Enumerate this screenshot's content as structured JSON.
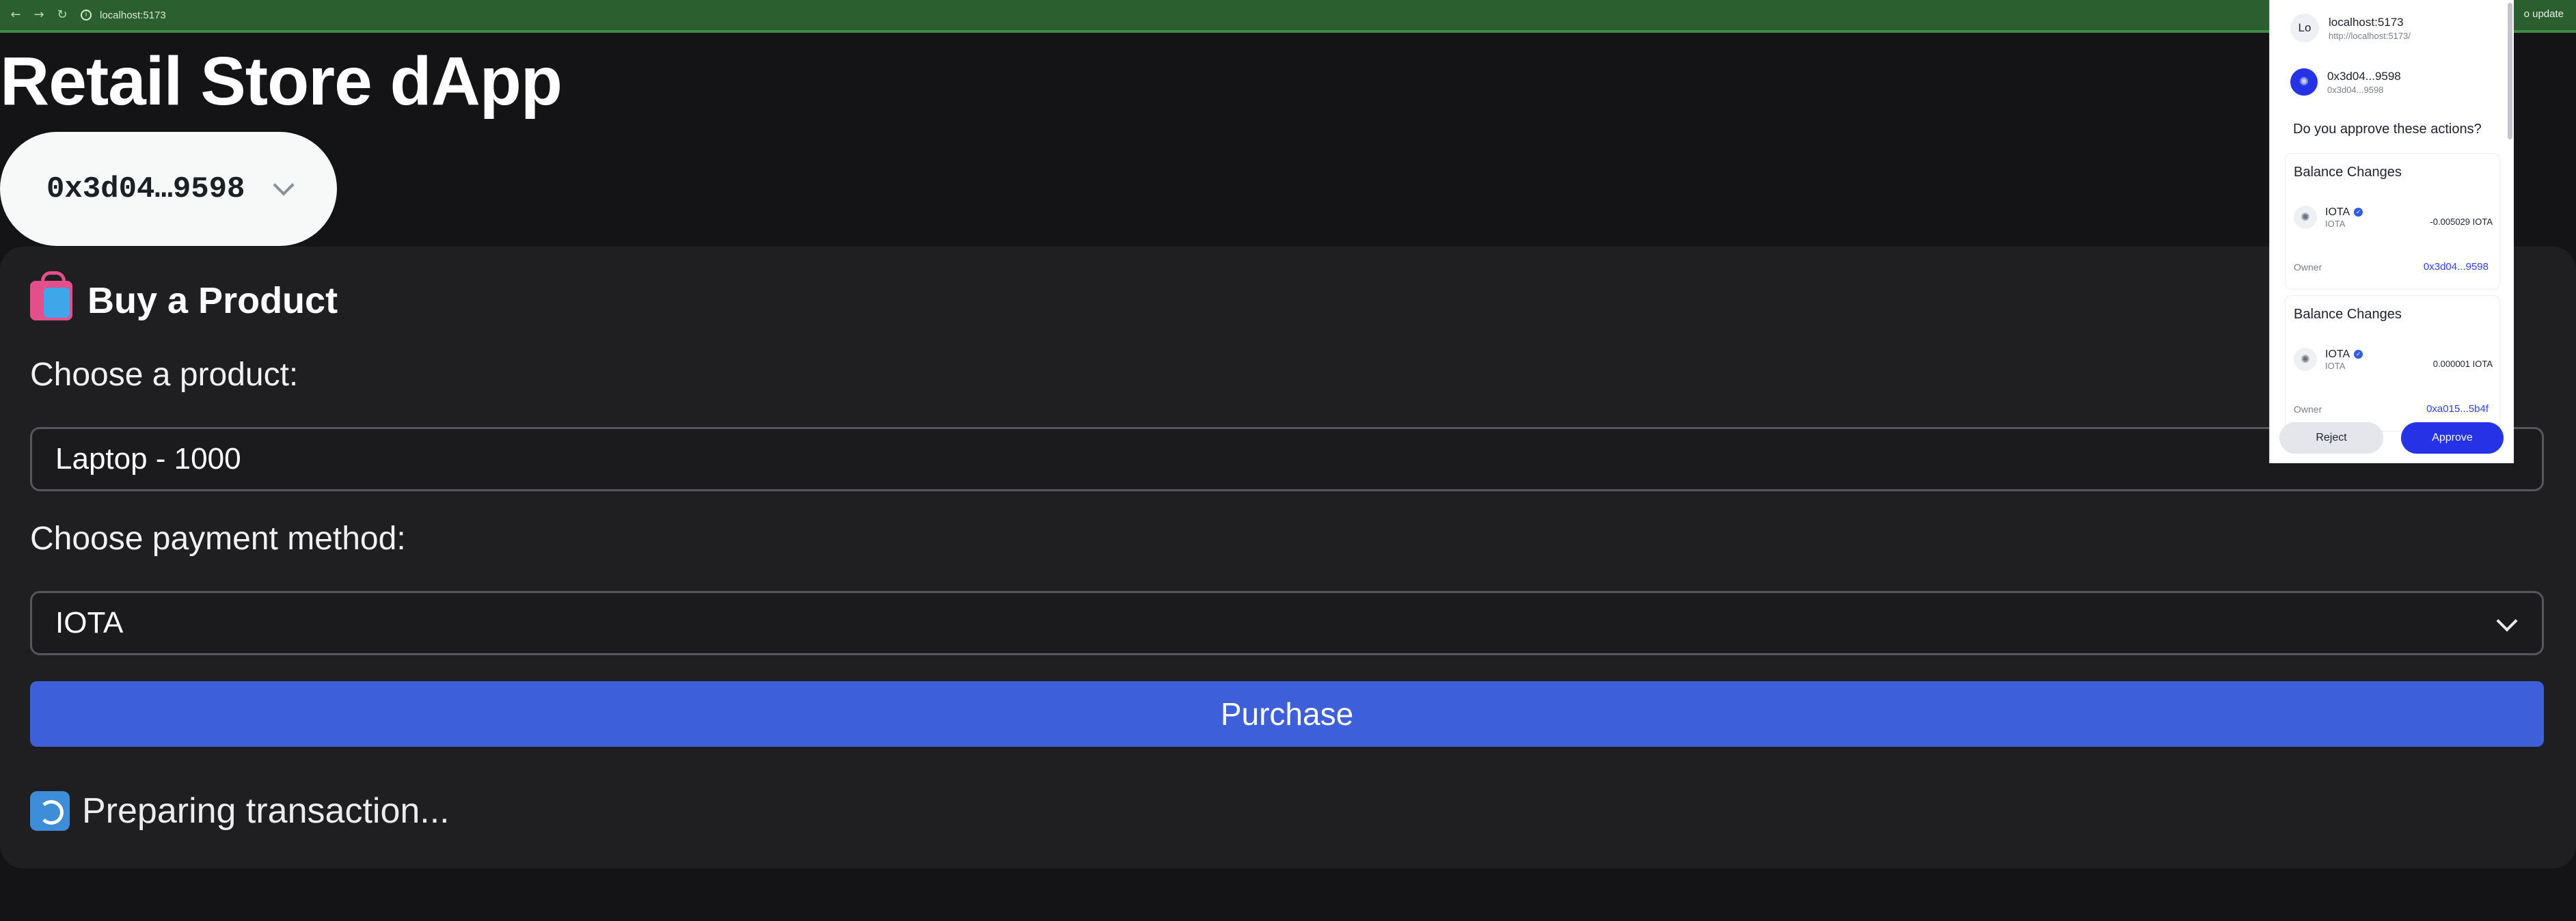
{
  "browser": {
    "url": "localhost:5173",
    "update_label": "o update"
  },
  "app": {
    "title": "Retail Store dApp",
    "account": "0x3d04…9598"
  },
  "card": {
    "heading": "Buy a Product",
    "product_label": "Choose a product:",
    "product_value": "Laptop - 1000",
    "payment_label": "Choose payment method:",
    "payment_value": "IOTA",
    "purchase_label": "Purchase",
    "status": "Preparing transaction..."
  },
  "wallet": {
    "site_initials": "Lo",
    "site_name": "localhost:5173",
    "site_url": "http://localhost:5173/",
    "account_name": "0x3d04...9598",
    "account_sub": "0x3d04...9598",
    "question": "Do you approve these actions?",
    "changes": [
      {
        "heading": "Balance Changes",
        "token": "IOTA",
        "token_sub": "IOTA",
        "amount": "-0.005029 IOTA",
        "owner_label": "Owner",
        "owner": "0x3d04...9598"
      },
      {
        "heading": "Balance Changes",
        "token": "IOTA",
        "token_sub": "IOTA",
        "amount": "0.000001 IOTA",
        "owner_label": "Owner",
        "owner": "0xa015...5b4f"
      }
    ],
    "reject_label": "Reject",
    "approve_label": "Approve"
  },
  "colors": {
    "accent": "#3d5fd9",
    "approve": "#2532e6",
    "browser_bar": "#2b5f2f"
  }
}
